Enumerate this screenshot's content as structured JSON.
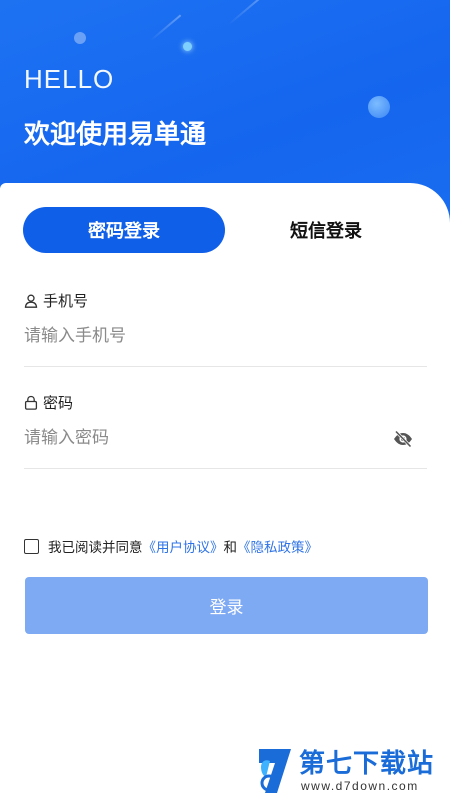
{
  "header": {
    "hello": "HELLO",
    "welcome": "欢迎使用易单通"
  },
  "tabs": [
    {
      "label": "密码登录",
      "active": true
    },
    {
      "label": "短信登录",
      "active": false
    }
  ],
  "phone": {
    "label": "手机号",
    "placeholder": "请输入手机号",
    "icon": "user-icon"
  },
  "password": {
    "label": "密码",
    "placeholder": "请输入密码",
    "icon": "lock-icon",
    "toggle_icon": "eye-off-icon"
  },
  "agreement": {
    "prefix": "我已阅读并同意",
    "user_agreement": "《用户协议》",
    "conjunction": "和",
    "privacy_policy": "《隐私政策》",
    "checked": false
  },
  "login_button": "登录",
  "watermark": {
    "title": "第七下载站",
    "url": "www.d7down.com"
  },
  "colors": {
    "primary": "#0f5fe8",
    "header": "#1565ee",
    "button_disabled": "#7ea9f3",
    "link": "#2f74e6"
  }
}
